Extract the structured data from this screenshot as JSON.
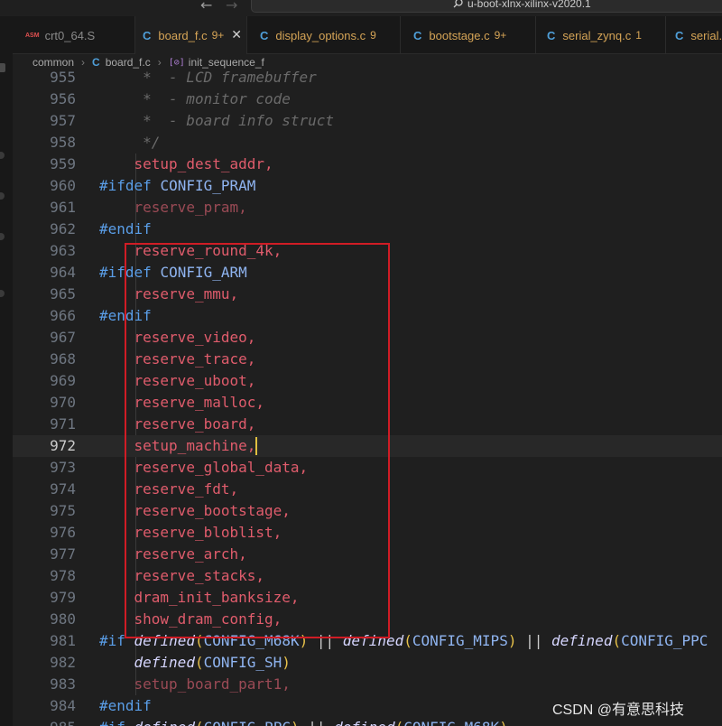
{
  "window": {
    "search_text": "u-boot-xlnx-xilinx-v2020.1"
  },
  "tabs": [
    {
      "icon": "ASM",
      "label": "crt0_64.S",
      "badge": "",
      "active": false
    },
    {
      "icon": "C",
      "label": "board_f.c",
      "badge": "9+",
      "active": true
    },
    {
      "icon": "C",
      "label": "display_options.c",
      "badge": "9",
      "active": false
    },
    {
      "icon": "C",
      "label": "bootstage.c",
      "badge": "9+",
      "active": false
    },
    {
      "icon": "C",
      "label": "serial_zynq.c",
      "badge": "1",
      "active": false
    },
    {
      "icon": "C",
      "label": "serial.c",
      "badge": "",
      "active": false
    }
  ],
  "breadcrumb": {
    "folder": "common",
    "file": "board_f.c",
    "symbol": "init_sequence_f"
  },
  "code_lines": [
    {
      "n": "955",
      "text": "*  - LCD framebuffer",
      "cls": "c-comment",
      "indent": 5
    },
    {
      "n": "956",
      "text": "*  - monitor code",
      "cls": "c-comment",
      "indent": 5
    },
    {
      "n": "957",
      "text": "*  - board info struct",
      "cls": "c-comment",
      "indent": 5
    },
    {
      "n": "958",
      "text": "*/",
      "cls": "c-comment",
      "indent": 5
    },
    {
      "n": "959",
      "text": "setup_dest_addr,",
      "cls": "c-fn",
      "indent": 4
    },
    {
      "n": "960",
      "text": "#ifdef CONFIG_PRAM",
      "cls": "pre",
      "indent": 0
    },
    {
      "n": "961",
      "text": "reserve_pram,",
      "cls": "c-fn-dim",
      "indent": 4
    },
    {
      "n": "962",
      "text": "#endif",
      "cls": "c-pre",
      "indent": 0
    },
    {
      "n": "963",
      "text": "reserve_round_4k,",
      "cls": "c-fn",
      "indent": 4
    },
    {
      "n": "964",
      "text": "#ifdef CONFIG_ARM",
      "cls": "pre",
      "indent": 0
    },
    {
      "n": "965",
      "text": "reserve_mmu,",
      "cls": "c-fn",
      "indent": 4
    },
    {
      "n": "966",
      "text": "#endif",
      "cls": "c-pre",
      "indent": 0
    },
    {
      "n": "967",
      "text": "reserve_video,",
      "cls": "c-fn",
      "indent": 4
    },
    {
      "n": "968",
      "text": "reserve_trace,",
      "cls": "c-fn",
      "indent": 4
    },
    {
      "n": "969",
      "text": "reserve_uboot,",
      "cls": "c-fn",
      "indent": 4
    },
    {
      "n": "970",
      "text": "reserve_malloc,",
      "cls": "c-fn",
      "indent": 4
    },
    {
      "n": "971",
      "text": "reserve_board,",
      "cls": "c-fn",
      "indent": 4
    },
    {
      "n": "972",
      "text": "setup_machine,",
      "cls": "c-fn",
      "indent": 4
    },
    {
      "n": "973",
      "text": "reserve_global_data,",
      "cls": "c-fn",
      "indent": 4
    },
    {
      "n": "974",
      "text": "reserve_fdt,",
      "cls": "c-fn",
      "indent": 4
    },
    {
      "n": "975",
      "text": "reserve_bootstage,",
      "cls": "c-fn",
      "indent": 4
    },
    {
      "n": "976",
      "text": "reserve_bloblist,",
      "cls": "c-fn",
      "indent": 4
    },
    {
      "n": "977",
      "text": "reserve_arch,",
      "cls": "c-fn",
      "indent": 4
    },
    {
      "n": "978",
      "text": "reserve_stacks,",
      "cls": "c-fn",
      "indent": 4
    },
    {
      "n": "979",
      "text": "dram_init_banksize,",
      "cls": "c-fn",
      "indent": 4
    },
    {
      "n": "980",
      "text": "show_dram_config,",
      "cls": "c-fn",
      "indent": 4
    },
    {
      "n": "981",
      "text": "#if defined(CONFIG_M68K) || defined(CONFIG_MIPS) || defined(CONFIG_PPC",
      "cls": "if",
      "indent": 0
    },
    {
      "n": "982",
      "text": "defined(CONFIG_SH)",
      "cls": "def",
      "indent": 4
    },
    {
      "n": "983",
      "text": "setup_board_part1,",
      "cls": "c-fn-dim",
      "indent": 4
    },
    {
      "n": "984",
      "text": "#endif",
      "cls": "c-pre",
      "indent": 0
    },
    {
      "n": "985",
      "text": "#if defined(CONFIG_PPC) || defined(CONFIG_M68K)",
      "cls": "if",
      "indent": 0
    }
  ],
  "current_line": "972",
  "watermark": "CSDN @有意思科技",
  "colors": {
    "highlight_box": "#d01c25",
    "function": "#e05c6c",
    "preprocessor": "#5a9ee8"
  }
}
